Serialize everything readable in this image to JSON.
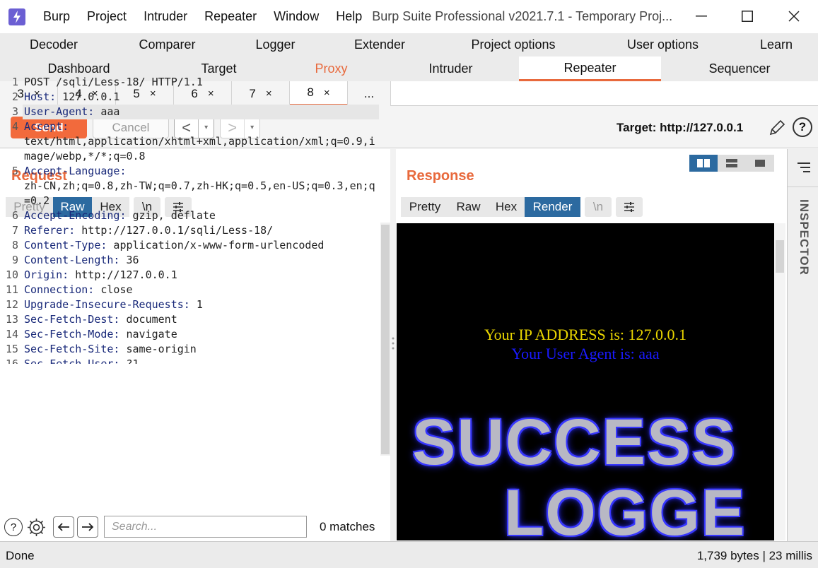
{
  "menu": [
    "Burp",
    "Project",
    "Intruder",
    "Repeater",
    "Window",
    "Help"
  ],
  "window_title": "Burp Suite Professional v2021.7.1 - Temporary Proj...",
  "tool_tabs_row1": [
    "Decoder",
    "Comparer",
    "Logger",
    "Extender",
    "Project options",
    "User options",
    "Learn"
  ],
  "tool_tabs_row2": [
    "Dashboard",
    "Target",
    "Proxy",
    "Intruder",
    "Repeater",
    "Sequencer"
  ],
  "repeater_tabs": [
    {
      "label": "3"
    },
    {
      "label": "4"
    },
    {
      "label": "5"
    },
    {
      "label": "6"
    },
    {
      "label": "7"
    },
    {
      "label": "8"
    }
  ],
  "repeater_more": "...",
  "close_glyph": "×",
  "toolbar": {
    "send_label": "Send",
    "cancel_label": "Cancel",
    "back_glyph": "<",
    "forward_glyph": ">",
    "dropdown_glyph": "▾",
    "target_label": "Target: http://127.0.0.1",
    "help_glyph": "?"
  },
  "request": {
    "title": "Request",
    "views": [
      "Pretty",
      "Raw",
      "Hex"
    ],
    "active_view": "Raw",
    "newline_btn": "\\n",
    "lines": [
      {
        "n": "1",
        "name": "",
        "rest": "POST /sqli/Less-18/ HTTP/1.1"
      },
      {
        "n": "2",
        "name": "Host:",
        "rest": " 127.0.0.1"
      },
      {
        "n": "3",
        "name": "User-Agent:",
        "rest": " aaa"
      },
      {
        "n": "4",
        "name": "Accept:",
        "rest": ""
      },
      {
        "n": "",
        "name": "",
        "rest": "text/html,application/xhtml+xml,application/xml;q=0.9,i"
      },
      {
        "n": "",
        "name": "",
        "rest": "mage/webp,*/*;q=0.8"
      },
      {
        "n": "5",
        "name": "Accept-Language:",
        "rest": ""
      },
      {
        "n": "",
        "name": "",
        "rest": "zh-CN,zh;q=0.8,zh-TW;q=0.7,zh-HK;q=0.5,en-US;q=0.3,en;q"
      },
      {
        "n": "",
        "name": "",
        "rest": "=0.2"
      },
      {
        "n": "6",
        "name": "Accept-Encoding:",
        "rest": " gzip, deflate"
      },
      {
        "n": "7",
        "name": "Referer:",
        "rest": " http://127.0.0.1/sqli/Less-18/"
      },
      {
        "n": "8",
        "name": "Content-Type:",
        "rest": " application/x-www-form-urlencoded"
      },
      {
        "n": "9",
        "name": "Content-Length:",
        "rest": " 36"
      },
      {
        "n": "10",
        "name": "Origin:",
        "rest": " http://127.0.0.1"
      },
      {
        "n": "11",
        "name": "Connection:",
        "rest": " close"
      },
      {
        "n": "12",
        "name": "Upgrade-Insecure-Requests:",
        "rest": " 1"
      },
      {
        "n": "13",
        "name": "Sec-Fetch-Dest:",
        "rest": " document"
      },
      {
        "n": "14",
        "name": "Sec-Fetch-Mode:",
        "rest": " navigate"
      },
      {
        "n": "15",
        "name": "Sec-Fetch-Site:",
        "rest": " same-origin"
      },
      {
        "n": "16",
        "name": "Sec-Fetch-User:",
        "rest": " ?1"
      }
    ],
    "search_placeholder": "Search...",
    "matches": "0 matches"
  },
  "response": {
    "title": "Response",
    "views": [
      "Pretty",
      "Raw",
      "Hex",
      "Render"
    ],
    "active_view": "Render",
    "newline_btn": "\\n",
    "render": {
      "ip_line": "Your IP ADDRESS is: 127.0.0.1",
      "ua_line": "Your User Agent is: aaa",
      "banner_line1": "SUCCESS",
      "banner_line2": "LOGGE"
    }
  },
  "inspector_label": "INSPECTOR",
  "status": {
    "left": "Done",
    "right": "1,739 bytes | 23 millis"
  },
  "colors": {
    "accent": "#e8693c",
    "send": "#f26a3c",
    "active_view": "#2c6aa0"
  }
}
